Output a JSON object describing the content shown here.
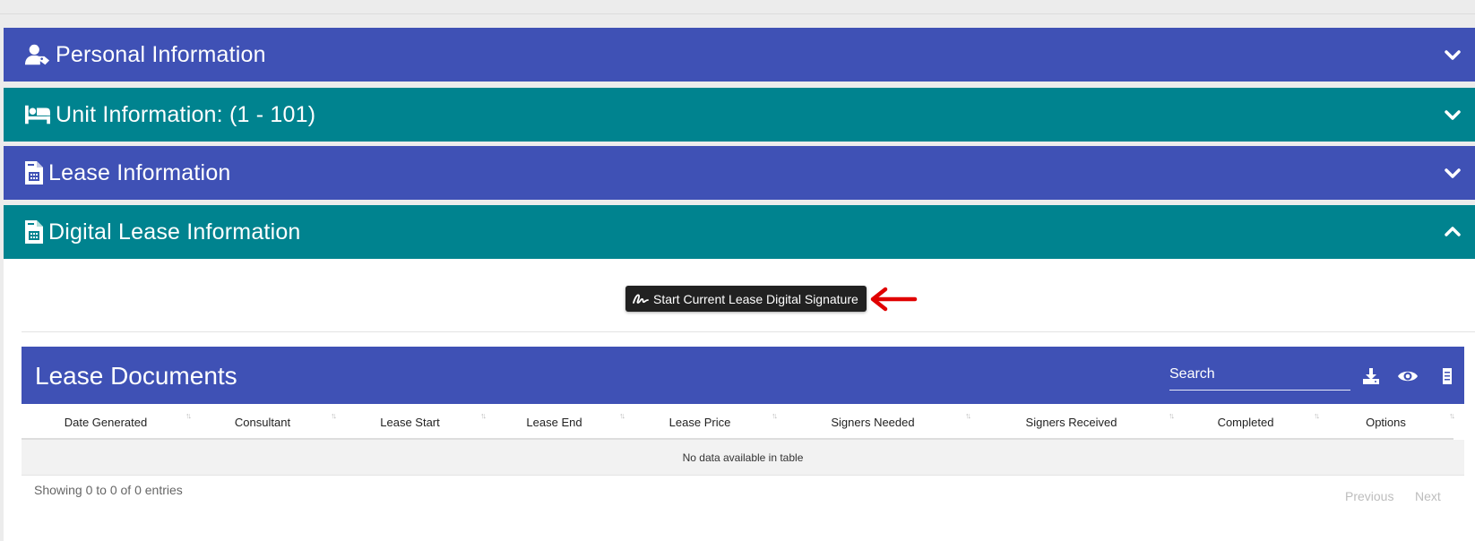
{
  "panels": [
    {
      "title": "Personal Information",
      "icon": "user-tag-icon",
      "color": "#3f51b5",
      "expanded": false
    },
    {
      "title": "Unit Information: (1 - 101)",
      "icon": "bed-icon",
      "color": "#00838f",
      "expanded": false
    },
    {
      "title": "Lease Information",
      "icon": "file-invoice-icon",
      "color": "#3f51b5",
      "expanded": false
    },
    {
      "title": "Digital Lease Information",
      "icon": "file-invoice-icon",
      "color": "#00838f",
      "expanded": true
    }
  ],
  "digital_lease": {
    "signature_button": "Start Current Lease Digital Signature",
    "signature_icon": "signature-icon",
    "annotation": "red-arrow-icon"
  },
  "lease_documents": {
    "title": "Lease Documents",
    "search_placeholder": "Search",
    "toolbar_icons": [
      "download-icon",
      "eye-icon",
      "columns-icon"
    ],
    "columns": [
      "Date Generated",
      "Consultant",
      "Lease Start",
      "Lease End",
      "Lease Price",
      "Signers Needed",
      "Signers Received",
      "Completed",
      "Options"
    ],
    "empty_message": "No data available in table",
    "info": "Showing 0 to 0 of 0 entries",
    "pager": {
      "previous": "Previous",
      "next": "Next"
    }
  },
  "colors": {
    "primary": "#3f51b5",
    "teal": "#00838f",
    "dark_button": "#212121",
    "arrow": "#e00000"
  }
}
